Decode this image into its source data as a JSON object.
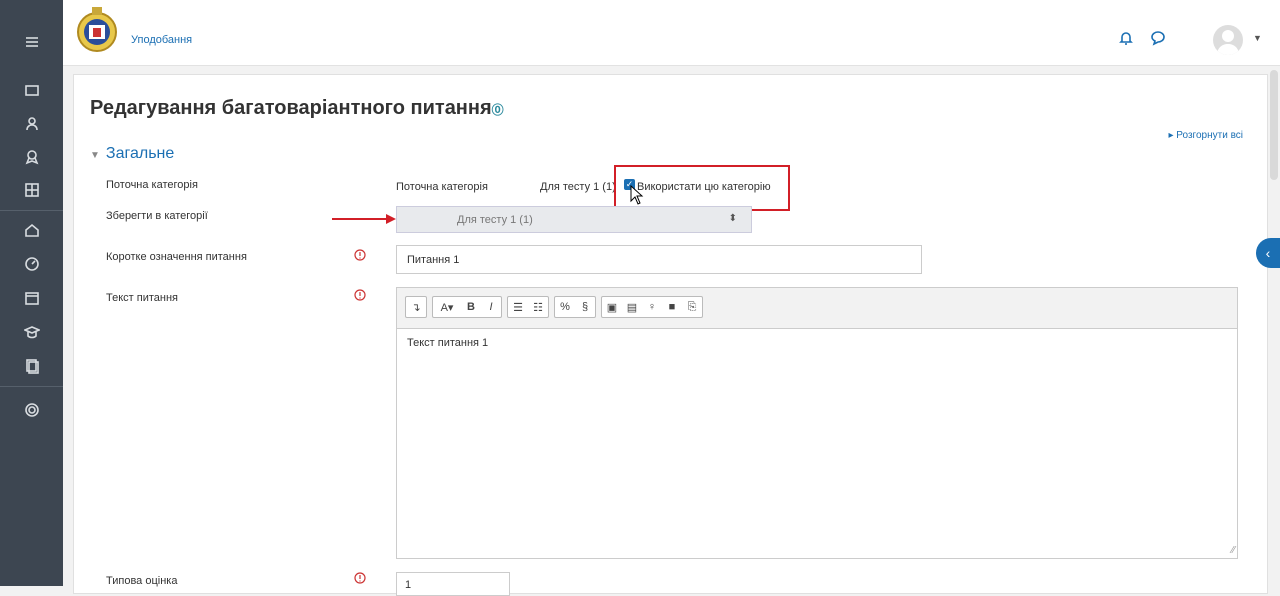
{
  "header": {
    "site_link": "Уподобання"
  },
  "page": {
    "title": "Редагування багатоваріантного питання",
    "expand_all": "Розгорнути всі",
    "section": "Загальне"
  },
  "form": {
    "current_category_label": "Поточна категорія",
    "current_category_static": "Поточна категорія",
    "current_category_value": "Для тесту 1 (1)",
    "use_category_label": "Використати цю категорію",
    "save_in_category_label": "Зберегти в категорії",
    "save_in_category_value": "Для тесту 1 (1)",
    "short_name_label": "Коротке означення питання",
    "short_name_value": "Питання 1",
    "question_text_label": "Текст питання",
    "question_text_value": "Текст питання 1",
    "default_mark_label": "Типова оцінка",
    "default_mark_value": "1"
  },
  "colors": {
    "accent": "#1b6fb3",
    "sidebar": "#3d4651",
    "highlight": "#d21f27"
  }
}
